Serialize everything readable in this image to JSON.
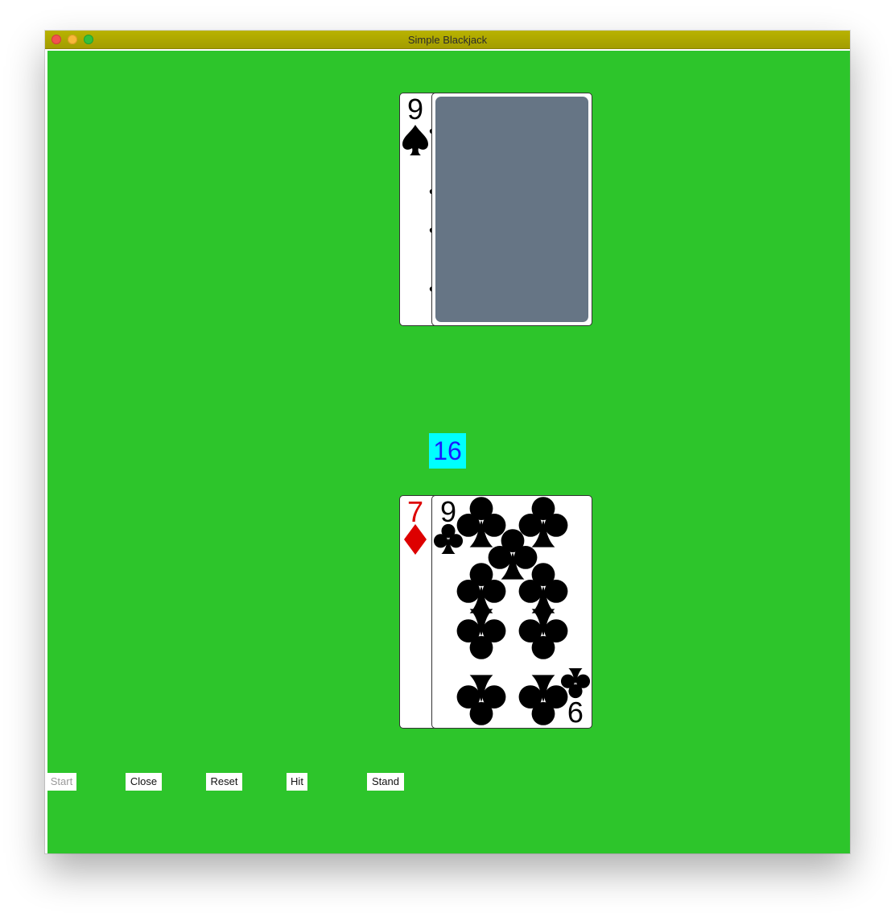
{
  "window": {
    "title": "Simple Blackjack"
  },
  "dealer": {
    "cards": [
      {
        "rank": "9",
        "suit": "spades",
        "color": "#000000",
        "face": "up"
      },
      {
        "face": "down",
        "color": "#667585"
      }
    ]
  },
  "player": {
    "score": "16",
    "cards": [
      {
        "rank": "7",
        "suit": "diamonds",
        "color": "#dd0000",
        "face": "up"
      },
      {
        "rank": "9",
        "suit": "clubs",
        "color": "#000000",
        "face": "up"
      }
    ]
  },
  "buttons": {
    "start": "Start",
    "close": "Close",
    "reset": "Reset",
    "hit": "Hit",
    "stand": "Stand"
  },
  "colors": {
    "felt": "#2dc52b",
    "score_bg": "#00ffff",
    "score_text": "#1a1aff",
    "title_bar": "#aca600"
  }
}
